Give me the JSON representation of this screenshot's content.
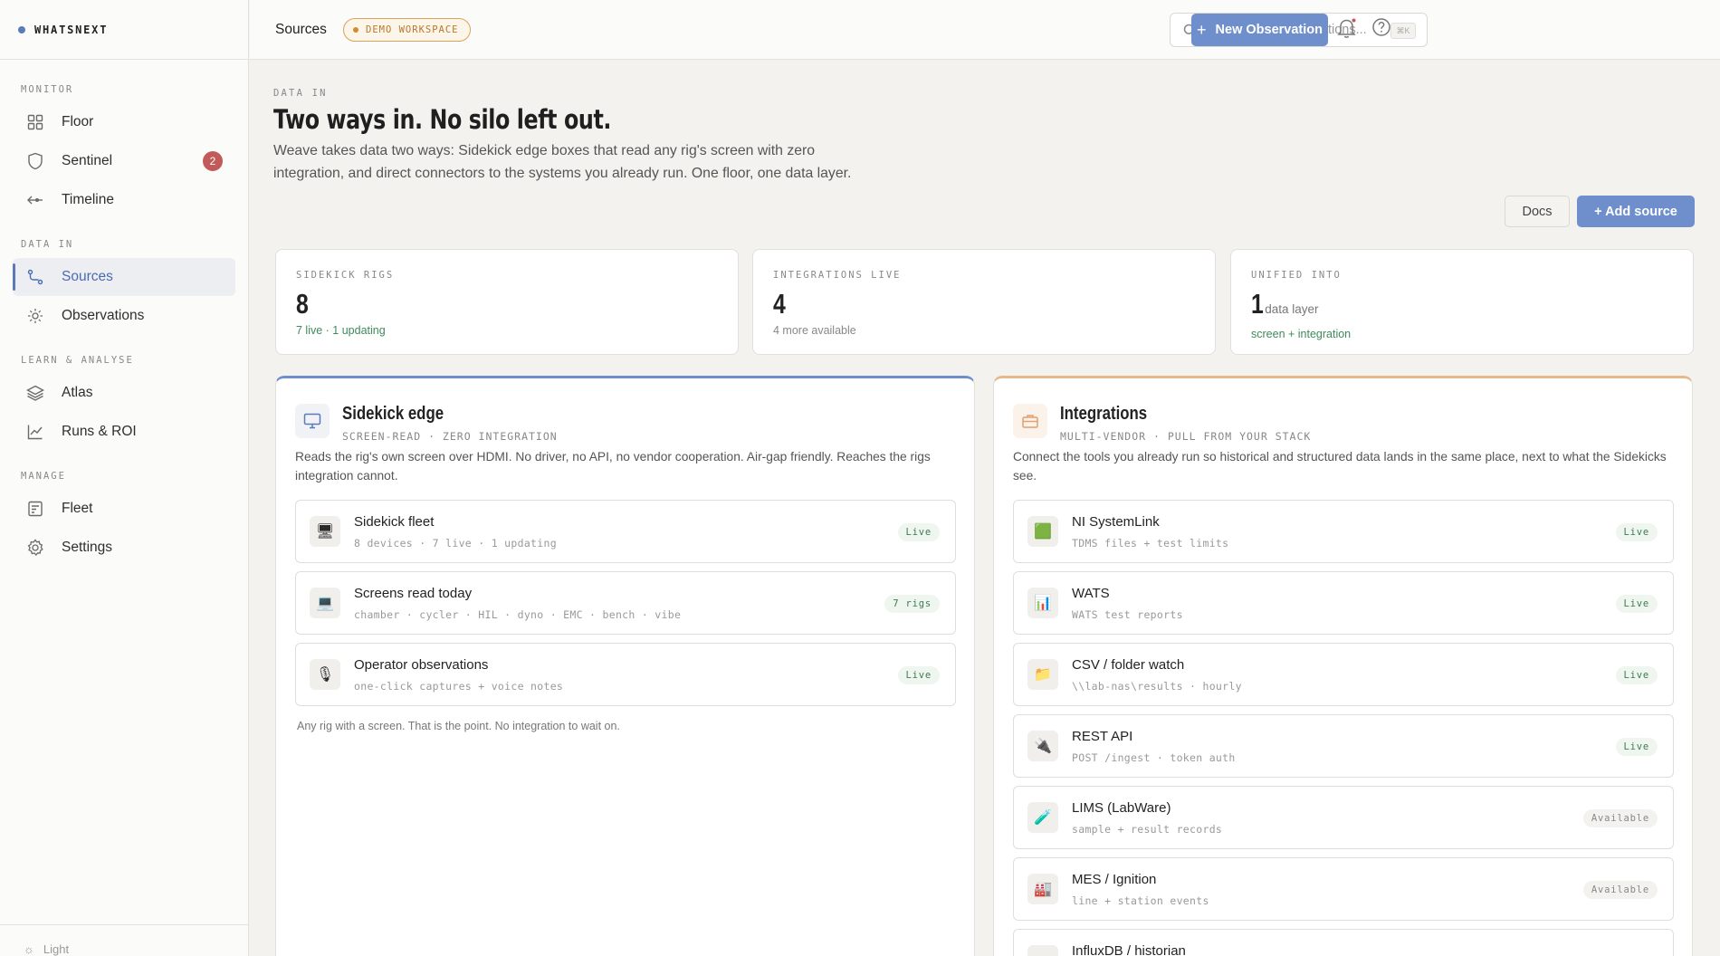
{
  "brand": {
    "name": "WHATSNEXT"
  },
  "sidebar": {
    "sections": {
      "monitor": "MONITOR",
      "data_in": "DATA IN",
      "learn": "LEARN & ANALYSE",
      "manage": "MANAGE"
    },
    "items": [
      {
        "label": "Floor",
        "icon": "grid-icon"
      },
      {
        "label": "Sentinel",
        "icon": "shield-icon",
        "badge": "2"
      },
      {
        "label": "Timeline",
        "icon": "timeline-icon"
      },
      {
        "label": "Sources",
        "icon": "route-icon",
        "active": true
      },
      {
        "label": "Observations",
        "icon": "sun-icon"
      },
      {
        "label": "Atlas",
        "icon": "layers-icon"
      },
      {
        "label": "Runs & ROI",
        "icon": "chart-icon"
      },
      {
        "label": "Fleet",
        "icon": "fleet-icon"
      },
      {
        "label": "Settings",
        "icon": "gear-icon"
      }
    ],
    "footer": "Light"
  },
  "topbar": {
    "title": "Sources",
    "chip": "DEMO WORKSPACE",
    "search_placeholder": "Search rigs, observations...",
    "search_kbd": "⌘K",
    "new_button": "New Observation"
  },
  "header": {
    "eyebrow": "DATA IN",
    "title": "Two ways in. No silo left out.",
    "lede": "Weave takes data two ways: Sidekick edge boxes that read any rig's screen with zero integration, and direct connectors to the systems you already run. One floor, one data layer.",
    "docs": "Docs",
    "add_source": "+ Add source"
  },
  "stats": [
    {
      "label": "SIDEKICK RIGS",
      "value": "8",
      "unit": "",
      "sub": "7 live · 1 updating",
      "tone": "green"
    },
    {
      "label": "INTEGRATIONS LIVE",
      "value": "4",
      "unit": "",
      "sub": "4 more available",
      "tone": "grey"
    },
    {
      "label": "UNIFIED INTO",
      "value": "1",
      "unit": "data layer",
      "sub": "screen + integration",
      "tone": "green"
    }
  ],
  "sidekick": {
    "title": "Sidekick edge",
    "subtitle": "SCREEN-READ · ZERO INTEGRATION",
    "desc": "Reads the rig's own screen over HDMI. No driver, no API, no vendor cooperation. Air-gap friendly. Reaches the rigs integration cannot.",
    "rows": [
      {
        "title": "Sidekick fleet",
        "meta": "8 devices · 7 live · 1 updating",
        "status": "Live",
        "icon": "monitor-icon",
        "emoji": "🖥"
      },
      {
        "title": "Screens read today",
        "meta": "chamber · cycler · HIL · dyno · EMC · bench · vibe",
        "status": "7 rigs",
        "icon": "desktop-icon",
        "emoji": "💻"
      },
      {
        "title": "Operator observations",
        "meta": "one-click captures + voice notes",
        "status": "Live",
        "icon": "microphone-icon",
        "emoji": "🎙"
      }
    ],
    "footer": "Any rig with a screen. That is the point. No integration to wait on."
  },
  "integrations": {
    "title": "Integrations",
    "subtitle": "MULTI-VENDOR · PULL FROM YOUR STACK",
    "desc": "Connect the tools you already run so historical and structured data lands in the same place, next to what the Sidekicks see.",
    "rows": [
      {
        "title": "NI SystemLink",
        "meta": "TDMS files + test limits",
        "status": "Live",
        "icon": "green-square-icon",
        "emoji": "🟩"
      },
      {
        "title": "WATS",
        "meta": "WATS test reports",
        "status": "Live",
        "icon": "bar-chart-icon",
        "emoji": "📊"
      },
      {
        "title": "CSV / folder watch",
        "meta": "\\\\lab-nas\\results · hourly",
        "status": "Live",
        "icon": "folder-icon",
        "emoji": "📁"
      },
      {
        "title": "REST API",
        "meta": "POST /ingest · token auth",
        "status": "Live",
        "icon": "plug-icon",
        "emoji": "🔌"
      },
      {
        "title": "LIMS (LabWare)",
        "meta": "sample + result records",
        "status": "Available",
        "icon": "test-tube-icon",
        "emoji": "🧪"
      },
      {
        "title": "MES / Ignition",
        "meta": "line + station events",
        "status": "Available",
        "icon": "factory-icon",
        "emoji": "🏭"
      },
      {
        "title": "InfluxDB / historian",
        "meta": "",
        "status": "",
        "icon": "database-icon",
        "emoji": ""
      }
    ]
  },
  "colors": {
    "accent": "#6f8fcc",
    "live": "#3f8a5a",
    "badge": "#c25a5a",
    "demo": "#d48a2e"
  }
}
